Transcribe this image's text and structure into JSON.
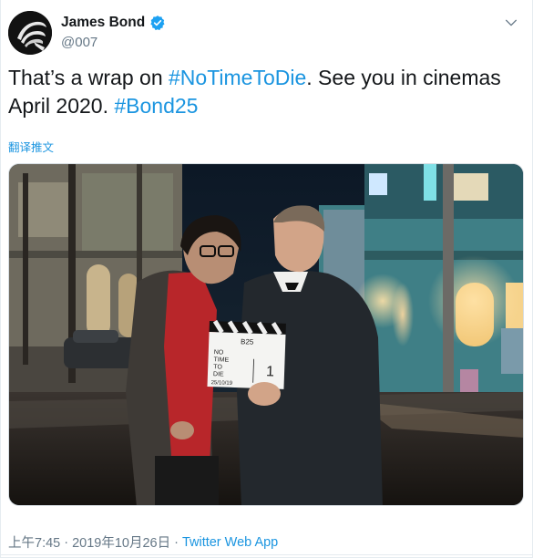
{
  "author": {
    "display_name": "James Bond",
    "handle": "@007",
    "verified": true,
    "avatar_icon": "bond-007-gun-logo-icon"
  },
  "tweet": {
    "text_parts": [
      {
        "text": "That’s a wrap on ",
        "type": "text"
      },
      {
        "text": "#NoTimeToDie",
        "type": "hashtag"
      },
      {
        "text": ". See you in cinemas April 2020. ",
        "type": "text"
      },
      {
        "text": "#Bond25",
        "type": "hashtag"
      }
    ],
    "translate_label": "翻译推文"
  },
  "media": {
    "clapperboard_lines": [
      "B25",
      "NO",
      "TIME",
      "TO",
      "DIE",
      "1",
      "25/10/19"
    ]
  },
  "meta": {
    "time": "上午7:45",
    "date": "2019年10月26日",
    "separator": "·",
    "source": "Twitter Web App"
  },
  "colors": {
    "accent": "#1b95e0",
    "secondary_text": "#657786",
    "primary_text": "#14171a"
  }
}
